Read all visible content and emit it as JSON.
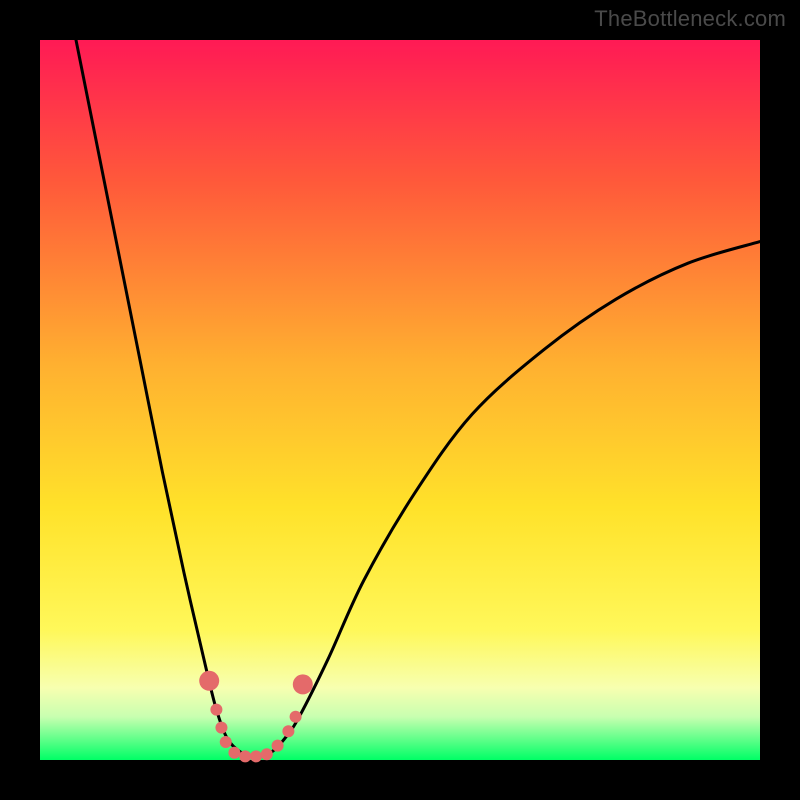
{
  "watermark": "TheBottleneck.com",
  "chart_data": {
    "type": "line",
    "title": "",
    "xlabel": "",
    "ylabel": "",
    "xlim": [
      0,
      1
    ],
    "ylim": [
      0,
      1
    ],
    "grid": false,
    "legend": false,
    "description": "Bottleneck-style curve on a vertical red-to-green gradient. A single black V-shaped curve descends steeply from the top-left, reaches a flat minimum around x≈0.30 near the bottom, then rises with decreasing slope toward the right edge (~y≈0.72 at x=1). Pink/coral dot markers cluster near the trough.",
    "gradient_stops": [
      {
        "pos": 0.0,
        "color": "#ff1a55"
      },
      {
        "pos": 0.2,
        "color": "#ff5a3a"
      },
      {
        "pos": 0.45,
        "color": "#ffb030"
      },
      {
        "pos": 0.65,
        "color": "#ffe22a"
      },
      {
        "pos": 0.82,
        "color": "#fff85a"
      },
      {
        "pos": 0.9,
        "color": "#f7ffb0"
      },
      {
        "pos": 0.94,
        "color": "#c8ffb0"
      },
      {
        "pos": 1.0,
        "color": "#00ff66"
      }
    ],
    "series": [
      {
        "name": "bottleneck-curve",
        "color": "#000000",
        "x": [
          0.05,
          0.08,
          0.11,
          0.14,
          0.17,
          0.2,
          0.23,
          0.245,
          0.26,
          0.28,
          0.3,
          0.32,
          0.34,
          0.36,
          0.4,
          0.45,
          0.52,
          0.6,
          0.7,
          0.8,
          0.9,
          1.0
        ],
        "y": [
          1.0,
          0.85,
          0.7,
          0.55,
          0.4,
          0.26,
          0.13,
          0.07,
          0.03,
          0.01,
          0.005,
          0.01,
          0.03,
          0.06,
          0.14,
          0.25,
          0.37,
          0.48,
          0.57,
          0.64,
          0.69,
          0.72
        ]
      }
    ],
    "markers": {
      "name": "trough-dots",
      "color": "#e46a6a",
      "radius_small": 6,
      "radius_large": 10,
      "points": [
        {
          "x": 0.235,
          "y": 0.11,
          "r": "large"
        },
        {
          "x": 0.245,
          "y": 0.07,
          "r": "small"
        },
        {
          "x": 0.252,
          "y": 0.045,
          "r": "small"
        },
        {
          "x": 0.258,
          "y": 0.025,
          "r": "small"
        },
        {
          "x": 0.27,
          "y": 0.01,
          "r": "small"
        },
        {
          "x": 0.285,
          "y": 0.005,
          "r": "small"
        },
        {
          "x": 0.3,
          "y": 0.005,
          "r": "small"
        },
        {
          "x": 0.315,
          "y": 0.008,
          "r": "small"
        },
        {
          "x": 0.33,
          "y": 0.02,
          "r": "small"
        },
        {
          "x": 0.345,
          "y": 0.04,
          "r": "small"
        },
        {
          "x": 0.355,
          "y": 0.06,
          "r": "small"
        },
        {
          "x": 0.365,
          "y": 0.105,
          "r": "large"
        }
      ]
    }
  }
}
